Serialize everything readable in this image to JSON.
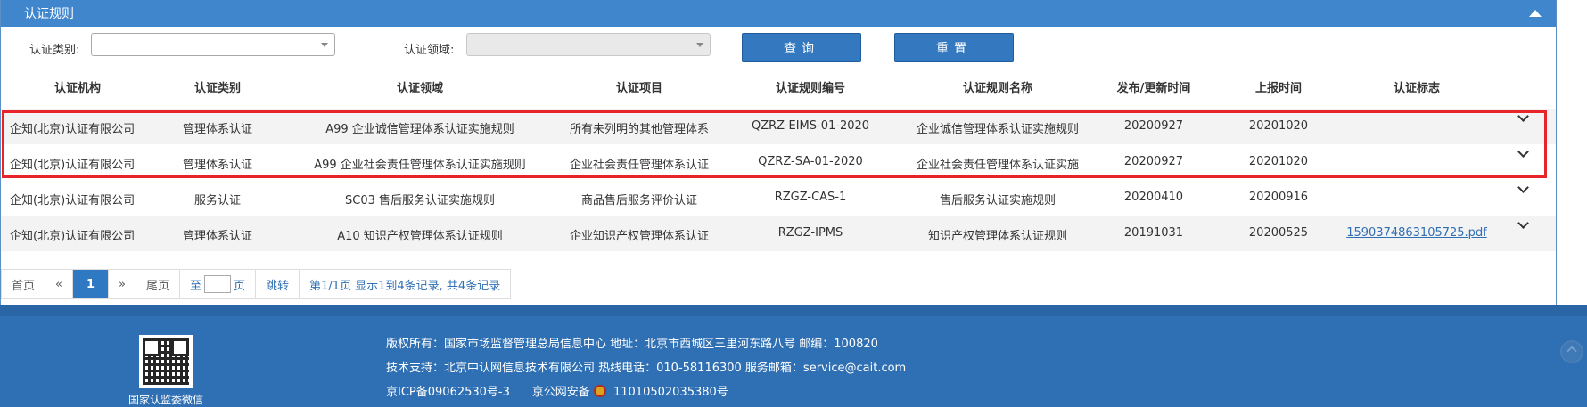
{
  "panel": {
    "title": "认证规则"
  },
  "filters": {
    "category_label": "认证类别:",
    "category_value": "",
    "domain_label": "认证领域:",
    "domain_value": "",
    "search_label": "查询",
    "reset_label": "重置"
  },
  "table": {
    "columns": [
      "认证机构",
      "认证类别",
      "认证领域",
      "认证项目",
      "认证规则编号",
      "认证规则名称",
      "发布/更新时间",
      "上报时间",
      "认证标志"
    ],
    "rows": [
      [
        "企知(北京)认证有限公司",
        "管理体系认证",
        "A99 企业诚信管理体系认证实施规则",
        "所有未列明的其他管理体系",
        "QZRZ-EIMS-01-2020",
        "企业诚信管理体系认证实施规则",
        "20200927",
        "20201020",
        ""
      ],
      [
        "企知(北京)认证有限公司",
        "管理体系认证",
        "A99 企业社会责任管理体系认证实施规则",
        "企业社会责任管理体系认证",
        "QZRZ-SA-01-2020",
        "企业社会责任管理体系认证实施",
        "20200927",
        "20201020",
        ""
      ],
      [
        "企知(北京)认证有限公司",
        "服务认证",
        "SC03 售后服务认证实施规则",
        "商品售后服务评价认证",
        "RZGZ-CAS-1",
        "售后服务认证实施规则",
        "20200410",
        "20200916",
        ""
      ],
      [
        "企知(北京)认证有限公司",
        "管理体系认证",
        "A10 知识产权管理体系认证规则",
        "企业知识产权管理体系认证",
        "RZGZ-IPMS",
        "知识产权管理体系认证规则",
        "20191031",
        "20200525",
        "1590374863105725.pdf"
      ]
    ]
  },
  "pager": {
    "first": "首页",
    "prev": "«",
    "current": "1",
    "next": "»",
    "last": "尾页",
    "to": "至",
    "page_unit": "页",
    "jump": "跳转",
    "summary": "第1/1页  显示1到4条记录, 共4条记录"
  },
  "footer": {
    "qr_caption": "国家认监委微信",
    "line1": "版权所有：国家市场监督管理总局信息中心    地址：北京市西城区三里河东路八号    邮编：100820",
    "line2": "技术支持：北京中认网信息技术有限公司    热线电话：010-58116300    服务邮箱：service@cait.com",
    "line3_icp": "京ICP备09062530号-3",
    "line3_police": "京公网安备",
    "line3_police_no": "11010502035380号"
  },
  "colors": {
    "header_blue": "#3f86cc",
    "button_blue": "#3479c0",
    "footer_blue": "#2f6fb3",
    "highlight_red": "#e8242b"
  }
}
